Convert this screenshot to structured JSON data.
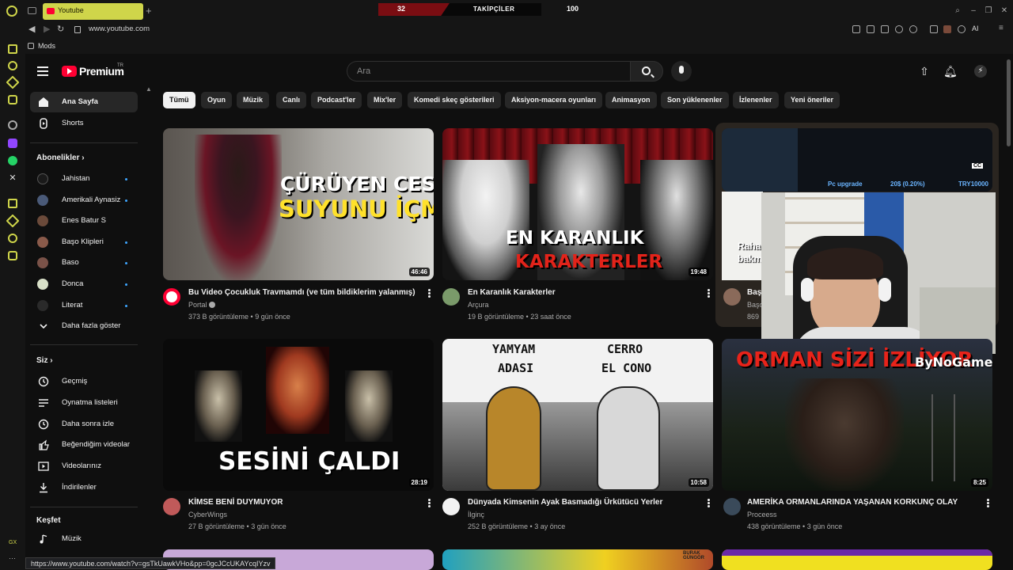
{
  "browser": {
    "tab_title": "Youtube",
    "url": "www.youtube.com",
    "bookmark": "Mods",
    "status_url": "https://www.youtube.com/watch?v=gsTkUawkVHo&pp=0gcJCcUKAYcqIYzv",
    "sidebar_label": "GX",
    "ai_label": "AI"
  },
  "follow_bar": {
    "left_value": "32",
    "title": "TAKİPÇİLER",
    "right_value": "100"
  },
  "masthead": {
    "logo_text": "Premium",
    "logo_country": "TR",
    "search_placeholder": "Ara"
  },
  "nav": {
    "items": [
      {
        "label": "Ana Sayfa",
        "icon": "home-icon"
      },
      {
        "label": "Shorts",
        "icon": "shorts-icon"
      }
    ],
    "subscriptions_title": "Abonelikler",
    "subscriptions": [
      {
        "label": "Jahistan",
        "dot": true,
        "color": "#1a1a1a"
      },
      {
        "label": "Amerikali Aynasiz",
        "dot": true,
        "color": "#4a5a78"
      },
      {
        "label": "Enes Batur S",
        "dot": false,
        "color": "#6b4a3a"
      },
      {
        "label": "Başo Klipleri",
        "dot": true,
        "color": "#8a5a4a"
      },
      {
        "label": "Baso",
        "dot": true,
        "color": "#7a5248"
      },
      {
        "label": "Donca",
        "dot": true,
        "color": "#d8e0c8"
      },
      {
        "label": "Literat",
        "dot": true,
        "color": "#2a2a2a"
      }
    ],
    "show_more": "Daha fazla göster",
    "you_title": "Siz",
    "you_items": [
      {
        "label": "Geçmiş",
        "icon": "history-icon"
      },
      {
        "label": "Oynatma listeleri",
        "icon": "playlists-icon"
      },
      {
        "label": "Daha sonra izle",
        "icon": "watch-later-icon"
      },
      {
        "label": "Beğendiğim videolar",
        "icon": "like-icon"
      },
      {
        "label": "Videolarınız",
        "icon": "your-videos-icon"
      },
      {
        "label": "İndirilenler",
        "icon": "download-icon"
      }
    ],
    "explore_title": "Keşfet",
    "explore_items": [
      {
        "label": "Müzik",
        "icon": "music-icon"
      }
    ]
  },
  "chips": [
    "Tümü",
    "Oyun",
    "Müzik",
    "Canlı",
    "Podcast'ler",
    "Mix'ler",
    "Komedi skeç gösterileri",
    "Aksiyon-macera oyunları",
    "Animasyon",
    "Son yüklenenler",
    "İzlenenler",
    "Yeni öneriler"
  ],
  "videos": [
    {
      "title": "Bu Video Çocukluk Travmamdı (ve tüm bildiklerim yalanmış)",
      "channel": "Portal",
      "verified": true,
      "meta": "373 B görüntüleme • 9 gün önce",
      "duration": "46:46",
      "thumb_line1": "ÇÜRÜYEN CESEDİN",
      "thumb_line2": "SUYUNU İÇMEK"
    },
    {
      "title": "En Karanlık Karakterler",
      "channel": "Arçura",
      "meta": "19 B görüntüleme • 23 saat önce",
      "duration": "19:48",
      "thumb_line1": "EN KARANLIK",
      "thumb_line2": "KARAKTERLER"
    },
    {
      "title_partial": "Başo",
      "channel_partial": "Başo",
      "meta_partial": "869",
      "thumb_partial_1": "Rahat",
      "thumb_partial_2": "bakm",
      "live_label_1": "Pc upgrade",
      "live_label_2": "20$ (0.20%)",
      "live_label_3": "TRY10000",
      "cc": "CC"
    },
    {
      "title": "KİMSE BENİ DUYMUYOR",
      "channel": "CyberWings",
      "meta": "27 B görüntüleme • 3 gün önce",
      "duration": "28:19",
      "thumb_line1": "SESİNİ ÇALDI"
    },
    {
      "title": "Dünyada Kimsenin Ayak Basmadığı Ürkütücü Yerler",
      "channel": "İlginç",
      "meta": "252 B görüntüleme • 3 ay önce",
      "duration": "10:58",
      "thumb_line1": "YAMYAM",
      "thumb_line2": "ADASI",
      "thumb_line3": "CERRO",
      "thumb_line4": "EL CONO"
    },
    {
      "title": "AMERİKA ORMANLARINDA YAŞANAN KORKUNÇ OLAY",
      "channel": "Proceess",
      "meta": "438 görüntüleme • 3 gün önce",
      "duration": "8:25",
      "thumb_line1": "ORMAN SİZİ İZLİYOR"
    }
  ],
  "overlay_brand": "ByNoGame",
  "bottom_thumb_label": "BURAK GÜNGÖR"
}
